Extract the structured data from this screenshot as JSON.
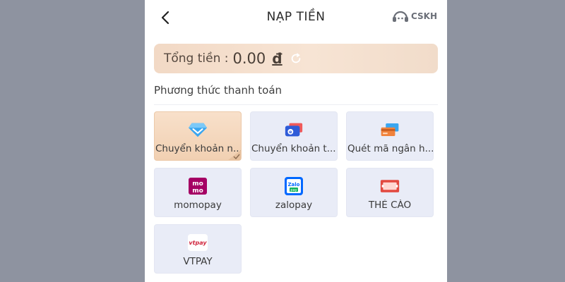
{
  "header": {
    "title": "NẠP TIỀN",
    "support_label": "CSKH"
  },
  "total": {
    "label": "Tổng tiền :",
    "amount": "0.00",
    "currency": "đ"
  },
  "payment": {
    "section_title": "Phương thức thanh toán",
    "methods": [
      {
        "label": "Chuyển khoản n...",
        "icon": "diamond-icon",
        "selected": true
      },
      {
        "label": "Chuyển khoản t...",
        "icon": "e-wallet-icon",
        "selected": false
      },
      {
        "label": "Quét mã ngân h...",
        "icon": "bank-cards-icon",
        "selected": false
      },
      {
        "label": "momopay",
        "icon": "momo-logo-icon",
        "selected": false
      },
      {
        "label": "zalopay",
        "icon": "zalopay-logo-icon",
        "selected": false
      },
      {
        "label": "THẺ CÀO",
        "icon": "scratch-card-icon",
        "selected": false
      },
      {
        "label": "VTPAY",
        "icon": "vtpay-logo-icon",
        "selected": false
      }
    ],
    "logo_text": {
      "momo_top": "mo",
      "momo_bottom": "mo",
      "zalo": "Zalo",
      "zalo_sub": "pay",
      "vtpay": "vtpay"
    }
  },
  "colors": {
    "page_bg": "#8e93a0",
    "total_bar": "#f2d9c5",
    "tile_bg": "#e9ecf7",
    "selected_tile": "#f4d6bc",
    "momo": "#a50064",
    "zalo": "#0068ff",
    "scratch_card": "#e2483f"
  }
}
